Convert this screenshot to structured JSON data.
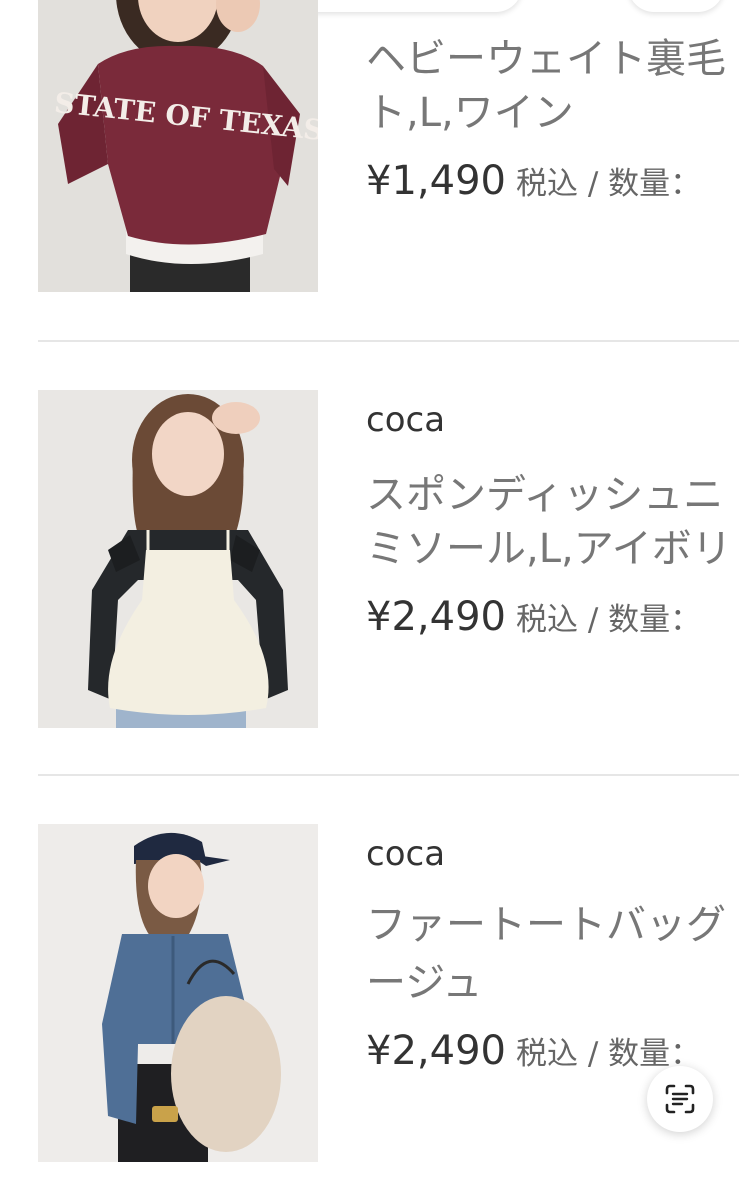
{
  "products": [
    {
      "brand": "",
      "title_line1": "ヘビーウェイト裏毛",
      "title_line2": "ト,L,ワイン",
      "price": "¥1,490",
      "tax_qty": "税込 / 数量：",
      "image_text": "STATE OF TEXAS"
    },
    {
      "brand": "coca",
      "title_line1": "スポンディッシュニ",
      "title_line2": "ミソール,L,アイボリ",
      "price": "¥2,490",
      "tax_qty": "税込 / 数量：",
      "image_text": ""
    },
    {
      "brand": "coca",
      "title_line1": "ファートートバッグ",
      "title_line2": "ージュ",
      "price": "¥2,490",
      "tax_qty": "税込 / 数量：",
      "image_text": ""
    }
  ],
  "scan_icon": "text-scan-icon",
  "colors": {
    "sweatshirt": "#7a2a3a",
    "photo_bg": "#e9e7e4",
    "denim": "#4f6f96",
    "cream": "#f3efe1"
  }
}
